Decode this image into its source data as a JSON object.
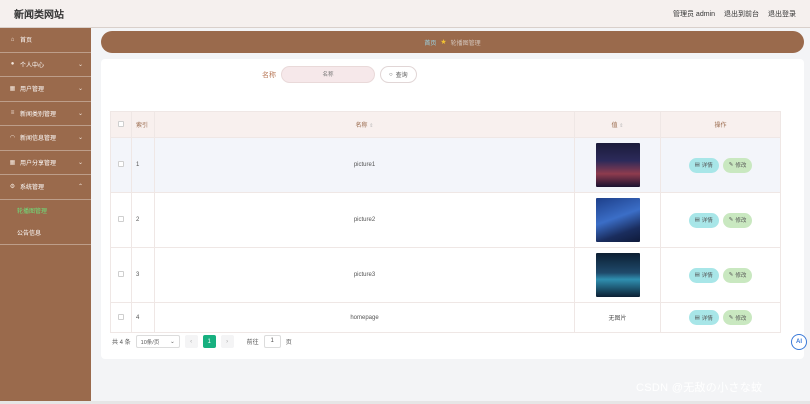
{
  "header": {
    "title": "新闻类网站",
    "user": "管理员 admin",
    "to_front": "退出到前台",
    "logout": "退出登录"
  },
  "sidebar": {
    "items": [
      {
        "label": "首页",
        "icon": "home-icon"
      },
      {
        "label": "个人中心",
        "icon": "user-icon"
      },
      {
        "label": "用户管理",
        "icon": "grid-icon"
      },
      {
        "label": "新闻类别管理",
        "icon": "bars-icon"
      },
      {
        "label": "新闻信息管理",
        "icon": "wifi-icon"
      },
      {
        "label": "用户分享管理",
        "icon": "grid-icon"
      },
      {
        "label": "系统管理",
        "icon": "gear-icon"
      }
    ],
    "sub_items": [
      {
        "label": "轮播图管理",
        "active": true
      },
      {
        "label": "公告信息",
        "active": false
      }
    ]
  },
  "breadcrumb": {
    "home": "首页",
    "current": "轮播图管理"
  },
  "search": {
    "label": "名称",
    "placeholder": "名称",
    "button": "查询"
  },
  "table": {
    "headers": {
      "index": "索引",
      "name": "名称",
      "value": "值",
      "ops": "操作"
    },
    "rows": [
      {
        "index": "1",
        "name": "picture1",
        "value": "",
        "image": "thumb-a"
      },
      {
        "index": "2",
        "name": "picture2",
        "value": "",
        "image": "thumb-b"
      },
      {
        "index": "3",
        "name": "picture3",
        "value": "",
        "image": "thumb-c"
      },
      {
        "index": "4",
        "name": "homepage",
        "value": "无图片",
        "image": ""
      }
    ],
    "detail_label": "详情",
    "edit_label": "修改"
  },
  "pagination": {
    "total": "共 4 条",
    "page_size": "10条/页",
    "current_page": "1",
    "goto_label": "前往",
    "goto_value": "1",
    "page_suffix": "页"
  },
  "ai_button": "AI",
  "watermark": "CSDN @无敌の小さな蚊",
  "colors": {
    "sidebar": "#9a6a4c",
    "active_menu": "#6ee07a",
    "pager_current": "#17b07f",
    "detail_button": "#a8e6e8",
    "edit_button": "#c9e8c0"
  }
}
